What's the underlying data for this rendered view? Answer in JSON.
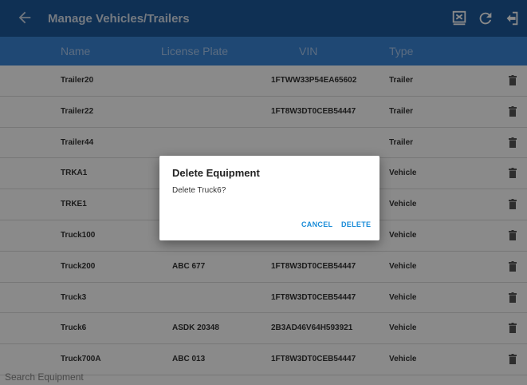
{
  "app_bar": {
    "title": "Manage Vehicles/Trailers",
    "icons": [
      "back-arrow-icon",
      "export-icon",
      "refresh-icon",
      "logout-icon"
    ]
  },
  "table": {
    "headers": [
      "Name",
      "License Plate",
      "VIN",
      "Type"
    ],
    "rows": [
      {
        "name": "Trailer20",
        "plate": "",
        "vin": "1FTWW33P54EA65602",
        "type": "Trailer"
      },
      {
        "name": "Trailer22",
        "plate": "",
        "vin": "1FT8W3DT0CEB54447",
        "type": "Trailer"
      },
      {
        "name": "Trailer44",
        "plate": "",
        "vin": "",
        "type": "Trailer"
      },
      {
        "name": "TRKA1",
        "plate": "",
        "vin": "",
        "type": "Vehicle"
      },
      {
        "name": "TRKE1",
        "plate": "",
        "vin": "",
        "type": "Vehicle"
      },
      {
        "name": "Truck100",
        "plate": "",
        "vin": "",
        "type": "Vehicle"
      },
      {
        "name": "Truck200",
        "plate": "ABC 677",
        "vin": "1FT8W3DT0CEB54447",
        "type": "Vehicle"
      },
      {
        "name": "Truck3",
        "plate": "",
        "vin": "1FT8W3DT0CEB54447",
        "type": "Vehicle"
      },
      {
        "name": "Truck6",
        "plate": "ASDK 20348",
        "vin": "2B3AD46V64H593921",
        "type": "Vehicle"
      },
      {
        "name": "Truck700A",
        "plate": "ABC 013",
        "vin": "1FT8W3DT0CEB54447",
        "type": "Vehicle"
      }
    ],
    "row_icon": "trash-icon"
  },
  "search": {
    "placeholder": "Search Equipment"
  },
  "dialog": {
    "title": "Delete Equipment",
    "message": "Delete Truck6?",
    "cancel_label": "CANCEL",
    "delete_label": "DELETE"
  },
  "colors": {
    "app_bar": "#1d5a9c",
    "header_row": "#3a86d6",
    "accent": "#1a8cd8"
  }
}
